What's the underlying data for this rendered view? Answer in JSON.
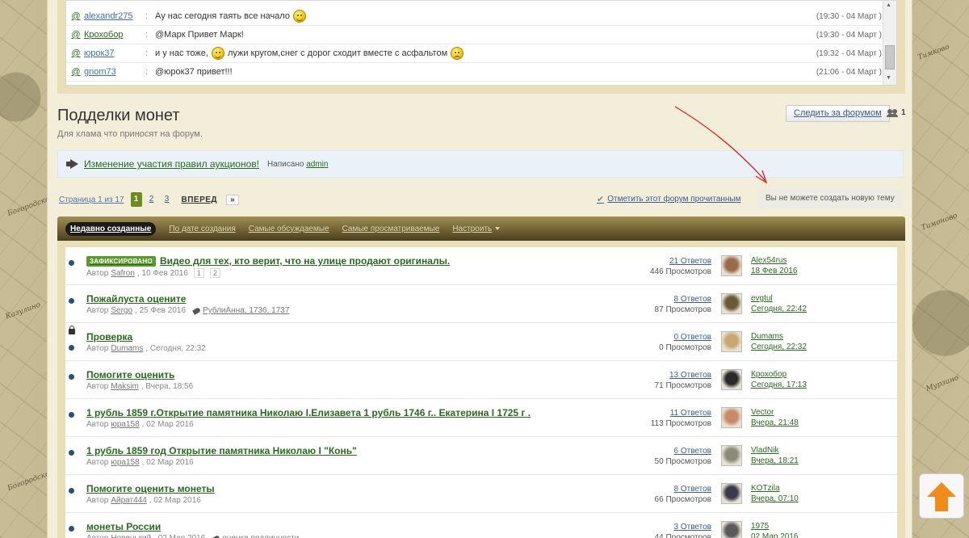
{
  "shoutbox": {
    "rows": [
      {
        "user": "alexandr275",
        "msg": "Ау нас сегодня таять все начало",
        "smile": "happy",
        "time": "(19:30 - 04 Март )"
      },
      {
        "user": "Крохобор",
        "msg": "@Марк Привет Марк!",
        "smile": "",
        "time": "(19:30 - 04 Март )"
      },
      {
        "user": "юрок37",
        "msg": "и у нас тоже,",
        "msg2": "лужи кругом,снег с дорог сходит вместе с асфальтом",
        "smile": "happy",
        "smile2": "mad",
        "time": "(19:32 - 04 Март )"
      },
      {
        "user": "gnom73",
        "msg": "@юрок37 привет!!!",
        "smile": "",
        "time": "(21:06 - 04 Март )"
      }
    ],
    "at_symbol": "@"
  },
  "forum": {
    "title": "Подделки монет",
    "description": "Для хлама что приносят на форум.",
    "follow_label": "Следить за форумом",
    "followers_count": "1"
  },
  "announcement": {
    "link": "Изменение участия правил аукционов!",
    "posted_by_label": "Написано",
    "author": "admin"
  },
  "pagination": {
    "info": "Страница 1 из 17",
    "pages": [
      "1",
      "2",
      "3"
    ],
    "next_label": "ВПЕРЕД",
    "last_label": "»",
    "mark_read": "Отметить этот форум прочитанным",
    "cant_create": "Вы не можете создать новую тему"
  },
  "filters": {
    "items": [
      "Недавно созданные",
      "По дате создания",
      "Самые обсуждаемые",
      "Самые просматриваемые",
      "Настроить"
    ]
  },
  "topics": [
    {
      "pinned_label": "ЗАФИКСИРОВАНО",
      "title": "Видео для тех, кто верит, что на улице продают оригиналы.",
      "by": "Автор",
      "author": "Safron",
      "date": ", 10 Фев 2016",
      "pages": [
        "1",
        "2"
      ],
      "tags": "",
      "replies": "21 Ответов",
      "views": "446 Просмотров",
      "last_user": "Alex54rus",
      "last_date": "18 Фев 2016",
      "locked": false,
      "avatar_color": "#9a6a4a"
    },
    {
      "pinned_label": "",
      "title": "Пожайлуста оцените",
      "by": "Автор",
      "author": "Sergo",
      "date": ", 25 Фев 2016",
      "pages": [],
      "tags": "РублиАнна, 1736, 1737",
      "replies": "8 Ответов",
      "views": "87 Просмотров",
      "last_user": "evgtul",
      "last_date": "Сегодня, 22:42",
      "locked": false,
      "avatar_color": "#6a5a3a"
    },
    {
      "pinned_label": "",
      "title": "Проверка",
      "by": "Автор",
      "author": "Dumams",
      "date": ", Сегодня, 22:32",
      "pages": [],
      "tags": "",
      "replies": "0 Ответов",
      "views": "0 Просмотров",
      "last_user": "Dumams",
      "last_date": "Сегодня, 22:32",
      "locked": true,
      "avatar_color": "#c8a870"
    },
    {
      "pinned_label": "",
      "title": "Помогите оценить",
      "by": "Автор",
      "author": "Maksim",
      "date": ", Вчера, 18:56",
      "pages": [],
      "tags": "",
      "replies": "13 Ответов",
      "views": "71 Просмотров",
      "last_user": "Крохобор",
      "last_date": "Сегодня, 17:13",
      "locked": false,
      "avatar_color": "#2a2a2a"
    },
    {
      "pinned_label": "",
      "title": "1 рубль 1859 г.Открытие памятника Николаю I.Елизавета 1 рубль 1746 г.. Екатерина I 1725 г .",
      "by": "Автор",
      "author": "юра158",
      "date": ", 02 Мар 2016",
      "pages": [],
      "tags": "",
      "replies": "11 Ответов",
      "views": "113 Просмотров",
      "last_user": "Vector",
      "last_date": "Вчера, 21:48",
      "locked": false,
      "avatar_color": "#c88a6a"
    },
    {
      "pinned_label": "",
      "title": "1 рубль 1859 год Открытие памятника Николаю I \"Конь\"",
      "by": "Автор",
      "author": "юра158",
      "date": ", 02 Мар 2016",
      "pages": [],
      "tags": "",
      "replies": "6 Ответов",
      "views": "50 Просмотров",
      "last_user": "VladNik",
      "last_date": "Вчера, 18:21",
      "locked": false,
      "avatar_color": "#8a8a7a"
    },
    {
      "pinned_label": "",
      "title": "Помогите оценить монеты",
      "by": "Автор",
      "author": "Айрат444",
      "date": ", 02 Мар 2016",
      "pages": [],
      "tags": "",
      "replies": "8 Ответов",
      "views": "66 Просмотров",
      "last_user": "KOTzila",
      "last_date": "Вчера, 07:10",
      "locked": false,
      "avatar_color": "#3a3a4a"
    },
    {
      "pinned_label": "",
      "title": "монеты России",
      "by": "Автор",
      "author": "Новенький",
      "date": ", 02 Мар 2016",
      "pages": [],
      "tags": "оценка подлинности",
      "replies": "3 Ответов",
      "views": "44 Просмотров",
      "last_user": "1975",
      "last_date": "02 Мар 2016",
      "locked": false,
      "avatar_color": "#5a5a5a"
    }
  ],
  "colors": {
    "accent_green": "#2a6a1f",
    "link_blue": "#3b5c94",
    "annotation_red": "#e02020",
    "back_to_top": "#f08c1a"
  }
}
